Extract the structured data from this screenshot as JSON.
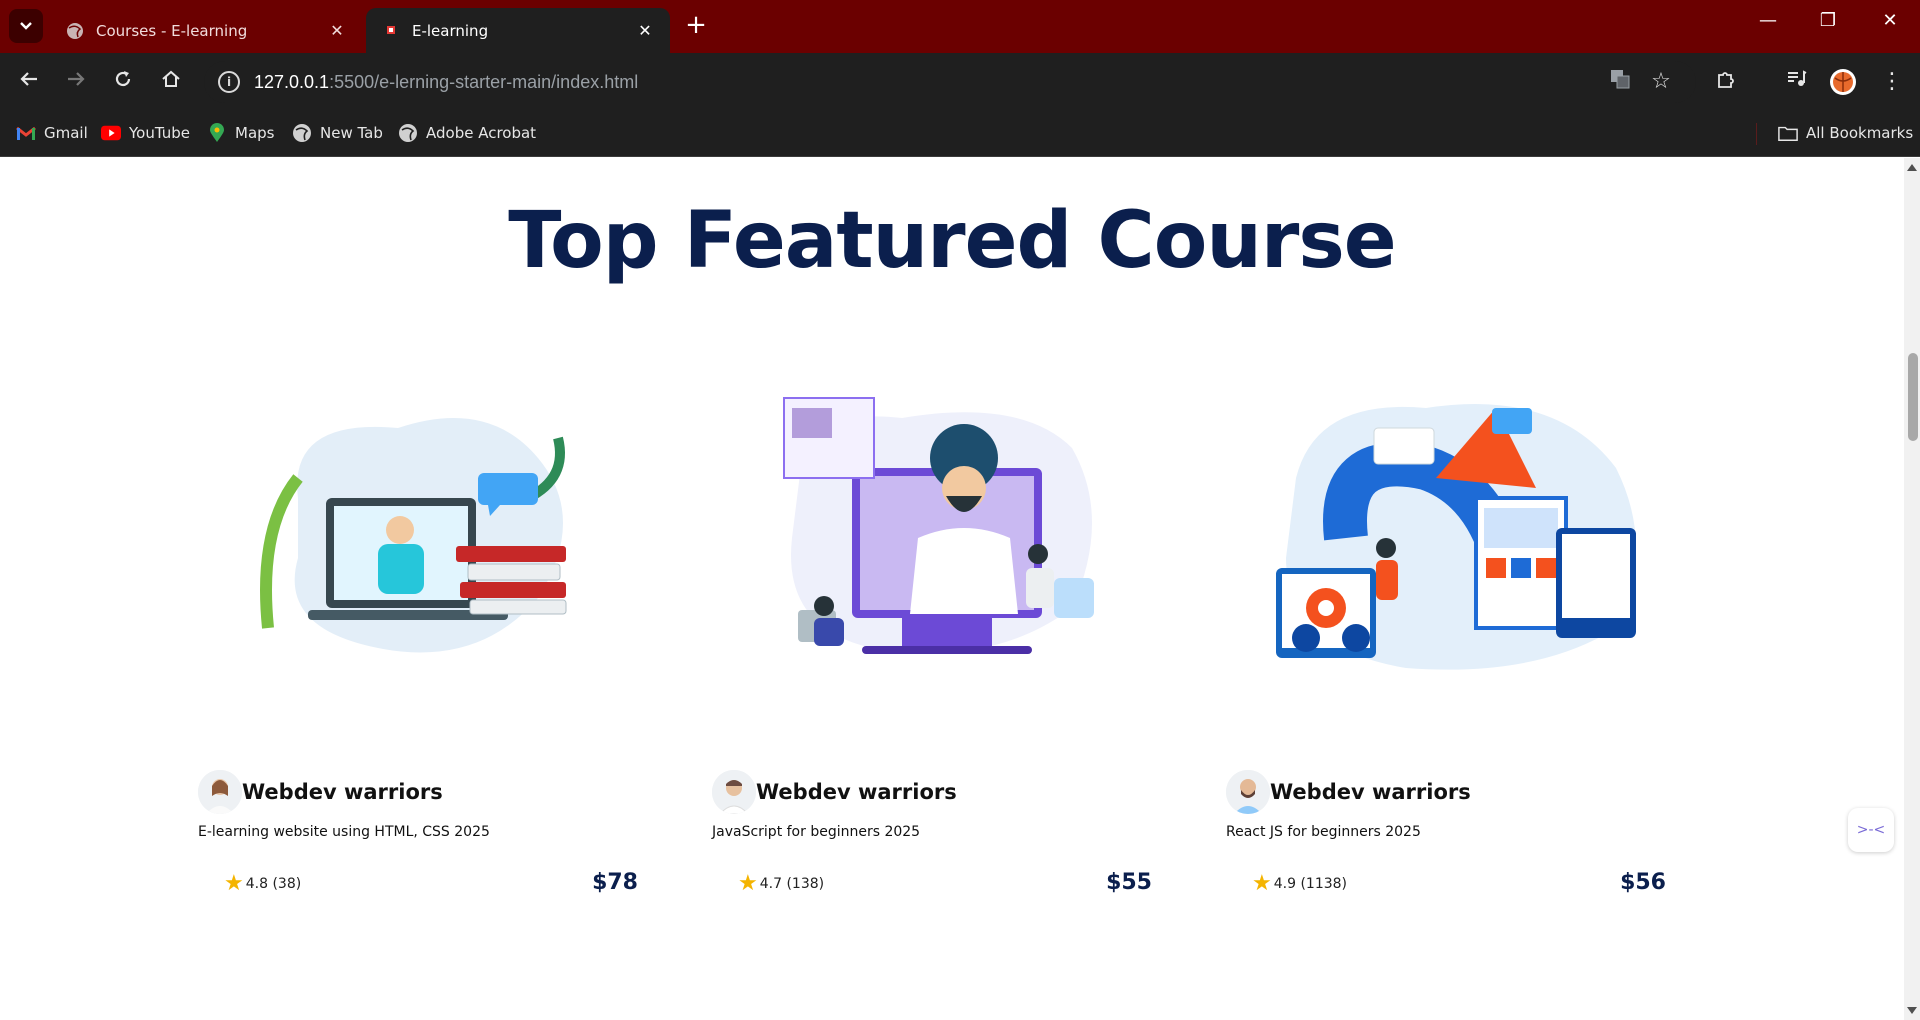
{
  "browser": {
    "tabs": [
      {
        "title": "Courses - E-learning",
        "active": false
      },
      {
        "title": "E-learning",
        "active": true
      }
    ],
    "url_host": "127.0.0.1",
    "url_rest": ":5500/e-lerning-starter-main/index.html",
    "bookmarks": [
      {
        "label": "Gmail",
        "icon": "gmail-icon"
      },
      {
        "label": "YouTube",
        "icon": "youtube-icon"
      },
      {
        "label": "Maps",
        "icon": "maps-icon"
      },
      {
        "label": "New Tab",
        "icon": "globe-icon"
      },
      {
        "label": "Adobe Acrobat",
        "icon": "globe-icon"
      }
    ],
    "all_bookmarks": "All Bookmarks",
    "colors": {
      "tabbar": "#6b0000",
      "toolbar": "#1f1f1f"
    }
  },
  "page": {
    "title": "Top Featured Course",
    "courses": [
      {
        "author": "Webdev warriors",
        "course": "E-learning website using HTML, CSS 2025",
        "rating": "4.8",
        "reviews": "(38)",
        "price": "$78",
        "illustration": "laptop-books-illustration"
      },
      {
        "author": "Webdev warriors",
        "course": "JavaScript for beginners 2025",
        "rating": "4.7",
        "reviews": "(138)",
        "price": "$55",
        "illustration": "video-call-illustration"
      },
      {
        "author": "Webdev warriors",
        "course": "React JS for beginners 2025",
        "rating": "4.9",
        "reviews": "(1138)",
        "price": "$56",
        "illustration": "developers-illustration"
      }
    ],
    "colors": {
      "title": "#0b1f4d",
      "price": "#0b1f4d",
      "star": "#f4b400"
    }
  }
}
